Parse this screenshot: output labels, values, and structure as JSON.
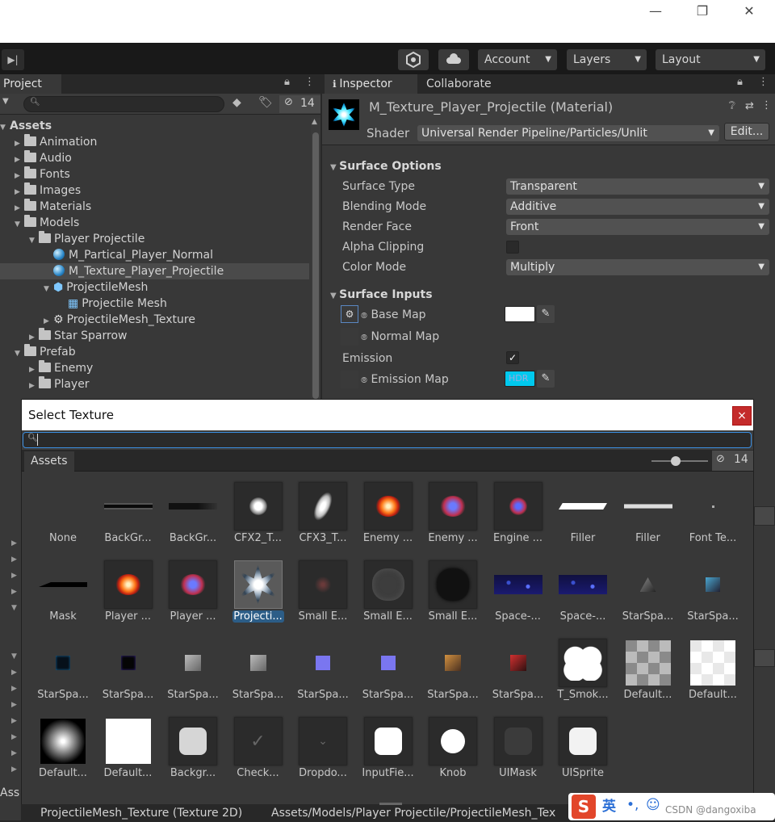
{
  "window": {
    "minimize": "—",
    "restore": "❐",
    "close": "✕"
  },
  "toolbar": {
    "step_label": "▶|",
    "account": "Account",
    "layers": "Layers",
    "layout": "Layout"
  },
  "project": {
    "tab": "Project",
    "hidden_count": "14",
    "tree": [
      {
        "label": "Assets",
        "depth": 0,
        "kind": "root"
      },
      {
        "label": "Animation",
        "depth": 1,
        "kind": "folder"
      },
      {
        "label": "Audio",
        "depth": 1,
        "kind": "folder"
      },
      {
        "label": "Fonts",
        "depth": 1,
        "kind": "folder"
      },
      {
        "label": "Images",
        "depth": 1,
        "kind": "folder"
      },
      {
        "label": "Materials",
        "depth": 1,
        "kind": "folder"
      },
      {
        "label": "Models",
        "depth": 1,
        "kind": "folder-open"
      },
      {
        "label": "Player Projectile",
        "depth": 2,
        "kind": "folder-open"
      },
      {
        "label": "M_Partical_Player_Normal",
        "depth": 3,
        "kind": "material"
      },
      {
        "label": "M_Texture_Player_Projectile",
        "depth": 3,
        "kind": "material",
        "selected": true
      },
      {
        "label": "ProjectileMesh",
        "depth": 3,
        "kind": "mesh"
      },
      {
        "label": "Projectile Mesh",
        "depth": 4,
        "kind": "grid"
      },
      {
        "label": "ProjectileMesh_Texture",
        "depth": 3,
        "kind": "texture"
      },
      {
        "label": "Star Sparrow",
        "depth": 2,
        "kind": "folder"
      },
      {
        "label": "Prefab",
        "depth": 1,
        "kind": "folder-open"
      },
      {
        "label": "Enemy",
        "depth": 2,
        "kind": "folder"
      },
      {
        "label": "Player",
        "depth": 2,
        "kind": "folder"
      }
    ],
    "footer": "Ass"
  },
  "inspector": {
    "tab": "Inspector",
    "tab2": "Collaborate",
    "material_name": "M_Texture_Player_Projectile (Material)",
    "shader_label": "Shader",
    "shader_value": "Universal Render Pipeline/Particles/Unlit",
    "edit_button": "Edit...",
    "surface_options": "Surface Options",
    "surface_type_label": "Surface Type",
    "surface_type": "Transparent",
    "blending_label": "Blending Mode",
    "blending": "Additive",
    "render_face_label": "Render Face",
    "render_face": "Front",
    "alpha_clip_label": "Alpha Clipping",
    "color_mode_label": "Color Mode",
    "color_mode": "Multiply",
    "surface_inputs": "Surface Inputs",
    "base_map": "Base Map",
    "normal_map": "Normal Map",
    "emission": "Emission",
    "emission_checked": "✓",
    "emission_map": "Emission Map",
    "hdr": "HDR"
  },
  "dialog": {
    "title": "Select Texture",
    "close": "×",
    "search_value": "",
    "tab": "Assets",
    "hidden_count": "14",
    "items": [
      {
        "label": "None",
        "kind": "none"
      },
      {
        "label": "BackGr...",
        "kind": "bar"
      },
      {
        "label": "BackGr...",
        "kind": "bar2"
      },
      {
        "label": "CFX2_T...",
        "kind": "glow",
        "boxed": true
      },
      {
        "label": "CFX3_T...",
        "kind": "flame",
        "boxed": true
      },
      {
        "label": "Enemy ...",
        "kind": "orange",
        "boxed": true
      },
      {
        "label": "Enemy ...",
        "kind": "bluered",
        "boxed": true
      },
      {
        "label": "Engine ...",
        "kind": "smallred",
        "boxed": true
      },
      {
        "label": "Filler",
        "kind": "filler"
      },
      {
        "label": "Filler",
        "kind": "filler2"
      },
      {
        "label": "Font Te...",
        "kind": "dot"
      },
      {
        "label": "Mask",
        "kind": "mask"
      },
      {
        "label": "Player ...",
        "kind": "orange",
        "boxed": true
      },
      {
        "label": "Player ...",
        "kind": "bluered",
        "boxed": true
      },
      {
        "label": "Projecti...",
        "kind": "burst",
        "selected": true
      },
      {
        "label": "Small E...",
        "kind": "smoke1",
        "boxed": true
      },
      {
        "label": "Small E...",
        "kind": "smoke2",
        "boxed": true
      },
      {
        "label": "Small E...",
        "kind": "smoke3",
        "boxed": true
      },
      {
        "label": "Space-...",
        "kind": "space"
      },
      {
        "label": "Space-...",
        "kind": "space"
      },
      {
        "label": "StarSpa...",
        "kind": "ship1"
      },
      {
        "label": "StarSpa...",
        "kind": "ship2"
      },
      {
        "label": "StarSpa...",
        "kind": "darkblue"
      },
      {
        "label": "StarSpa...",
        "kind": "darkblue2"
      },
      {
        "label": "StarSpa...",
        "kind": "gray"
      },
      {
        "label": "StarSpa...",
        "kind": "gray"
      },
      {
        "label": "StarSpa...",
        "kind": "purple"
      },
      {
        "label": "StarSpa...",
        "kind": "purple"
      },
      {
        "label": "StarSpa...",
        "kind": "brown"
      },
      {
        "label": "StarSpa...",
        "kind": "redship"
      },
      {
        "label": "T_Smok...",
        "kind": "cloud",
        "boxed": true
      },
      {
        "label": "Default...",
        "kind": "checker"
      },
      {
        "label": "Default...",
        "kind": "checkerw"
      },
      {
        "label": "Default...",
        "kind": "radial"
      },
      {
        "label": "Default...",
        "kind": "white"
      },
      {
        "label": "Backgr...",
        "kind": "roundgray",
        "boxed": true
      },
      {
        "label": "Check...",
        "kind": "check",
        "boxed": true
      },
      {
        "label": "Dropdo...",
        "kind": "chev",
        "boxed": true
      },
      {
        "label": "InputFie...",
        "kind": "roundwhite",
        "boxed": true
      },
      {
        "label": "Knob",
        "kind": "knob",
        "boxed": true
      },
      {
        "label": "UIMask",
        "kind": "uimask",
        "boxed": true
      },
      {
        "label": "UISprite",
        "kind": "roundwhite2",
        "boxed": true
      }
    ]
  },
  "status": {
    "left": "ProjectileMesh_Texture (Texture 2D)",
    "right": "Assets/Models/Player Projectile/ProjectileMesh_Tex",
    "ime_logo": "S",
    "ime_lang": "英",
    "watermark": "CSDN @dangoxiba"
  }
}
